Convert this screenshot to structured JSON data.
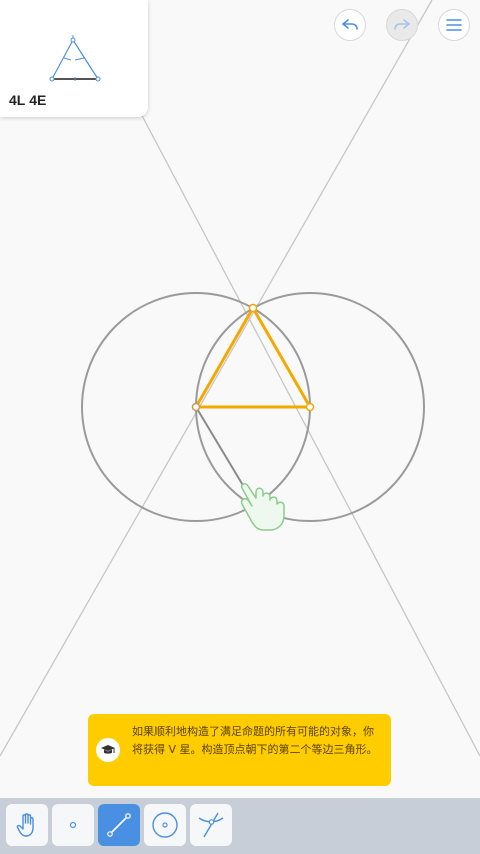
{
  "goal": {
    "score_l": "4L",
    "score_e": "4E"
  },
  "hint": {
    "text": "如果顺利地构造了满足命题的所有可能的对象，你将获得 V 星。构造顶点朝下的第二个等边三角形。"
  },
  "top_buttons": {
    "undo_icon": "undo-icon",
    "redo_icon": "redo-icon",
    "menu_icon": "menu-icon"
  },
  "toolbar": {
    "tools": [
      "hand-tool",
      "point-tool",
      "line-tool",
      "circle-tool",
      "intersect-tool"
    ],
    "active_tool": "line-tool"
  },
  "colors": {
    "construction": "#a0a0a0",
    "accent": "#f5a800",
    "hint_bg": "#ffcc00",
    "active_tool": "#4a90e2",
    "toolbar_bg": "#c8ced8",
    "hand_gesture": "#7ac77a"
  }
}
